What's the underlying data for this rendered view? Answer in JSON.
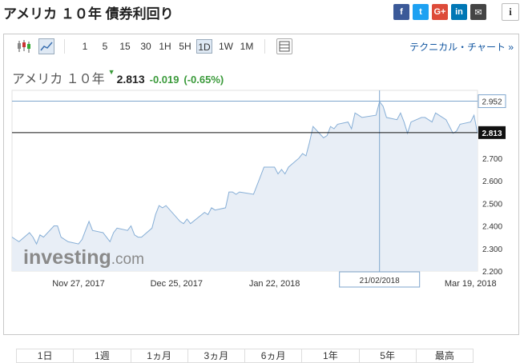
{
  "header": {
    "title": "アメリカ １０年 債券利回り",
    "social": [
      {
        "icon": "facebook-icon",
        "glyph": "f",
        "color": "#3b5998"
      },
      {
        "icon": "twitter-icon",
        "glyph": "t",
        "color": "#1da1f2"
      },
      {
        "icon": "google-plus-icon",
        "glyph": "G+",
        "color": "#dd4b39"
      },
      {
        "icon": "linkedin-icon",
        "glyph": "in",
        "color": "#0077b5"
      },
      {
        "icon": "email-icon",
        "glyph": "✉",
        "color": "#444444"
      }
    ],
    "info_glyph": "i"
  },
  "toolbar": {
    "intervals": [
      "1",
      "5",
      "15",
      "30",
      "1H",
      "5H",
      "1D",
      "1W",
      "1M"
    ],
    "selected": "1D",
    "technical_link": "テクニカル・チャート »"
  },
  "quote": {
    "name": "アメリカ １０年",
    "arrow": "▼",
    "price": "2.813",
    "change": "-0.019",
    "change_pct": "(-0.65%)",
    "change_color": "#3a9a3a"
  },
  "watermark": {
    "brand": "investing",
    "suffix": ".com"
  },
  "chart_data": {
    "type": "area",
    "x": [
      "2017-11-08",
      "2017-11-09",
      "2017-11-10",
      "2017-11-13",
      "2017-11-14",
      "2017-11-15",
      "2017-11-16",
      "2017-11-17",
      "2017-11-20",
      "2017-11-21",
      "2017-11-22",
      "2017-11-24",
      "2017-11-27",
      "2017-11-28",
      "2017-11-29",
      "2017-11-30",
      "2017-12-01",
      "2017-12-04",
      "2017-12-05",
      "2017-12-06",
      "2017-12-07",
      "2017-12-08",
      "2017-12-11",
      "2017-12-12",
      "2017-12-13",
      "2017-12-14",
      "2017-12-15",
      "2017-12-18",
      "2017-12-19",
      "2017-12-20",
      "2017-12-21",
      "2017-12-22",
      "2017-12-26",
      "2017-12-27",
      "2017-12-28",
      "2017-12-29",
      "2018-01-02",
      "2018-01-03",
      "2018-01-04",
      "2018-01-05",
      "2018-01-08",
      "2018-01-09",
      "2018-01-10",
      "2018-01-11",
      "2018-01-12",
      "2018-01-16",
      "2018-01-17",
      "2018-01-18",
      "2018-01-19",
      "2018-01-22",
      "2018-01-23",
      "2018-01-24",
      "2018-01-25",
      "2018-01-26",
      "2018-01-29",
      "2018-01-30",
      "2018-01-31",
      "2018-02-01",
      "2018-02-02",
      "2018-02-05",
      "2018-02-06",
      "2018-02-07",
      "2018-02-08",
      "2018-02-09",
      "2018-02-12",
      "2018-02-13",
      "2018-02-14",
      "2018-02-15",
      "2018-02-16",
      "2018-02-20",
      "2018-02-21",
      "2018-02-22",
      "2018-02-23",
      "2018-02-26",
      "2018-02-27",
      "2018-02-28",
      "2018-03-01",
      "2018-03-02",
      "2018-03-05",
      "2018-03-06",
      "2018-03-07",
      "2018-03-08",
      "2018-03-09",
      "2018-03-12",
      "2018-03-13",
      "2018-03-14",
      "2018-03-15",
      "2018-03-16",
      "2018-03-19",
      "2018-03-20",
      "2018-03-21"
    ],
    "values": [
      2.35,
      2.34,
      2.33,
      2.37,
      2.35,
      2.32,
      2.36,
      2.35,
      2.4,
      2.4,
      2.35,
      2.33,
      2.32,
      2.34,
      2.38,
      2.42,
      2.38,
      2.37,
      2.35,
      2.33,
      2.37,
      2.39,
      2.38,
      2.4,
      2.36,
      2.35,
      2.35,
      2.39,
      2.45,
      2.49,
      2.48,
      2.49,
      2.42,
      2.41,
      2.43,
      2.41,
      2.46,
      2.45,
      2.48,
      2.47,
      2.48,
      2.55,
      2.55,
      2.54,
      2.55,
      2.54,
      2.58,
      2.62,
      2.66,
      2.66,
      2.63,
      2.65,
      2.63,
      2.66,
      2.7,
      2.72,
      2.71,
      2.77,
      2.84,
      2.79,
      2.8,
      2.84,
      2.83,
      2.85,
      2.86,
      2.83,
      2.9,
      2.89,
      2.88,
      2.89,
      2.95,
      2.93,
      2.88,
      2.87,
      2.9,
      2.86,
      2.81,
      2.86,
      2.88,
      2.88,
      2.87,
      2.86,
      2.9,
      2.87,
      2.84,
      2.81,
      2.82,
      2.85,
      2.86,
      2.89,
      2.81
    ],
    "ylim": [
      2.2,
      3.0
    ],
    "y_ticks": [
      "2.200",
      "2.300",
      "2.400",
      "2.500",
      "2.600",
      "2.700"
    ],
    "x_tick_labels": [
      {
        "date": "2017-11-27",
        "label": "Nov 27, 2017"
      },
      {
        "date": "2017-12-25",
        "label": "Dec 25, 2017"
      },
      {
        "date": "2018-01-22",
        "label": "Jan 22, 2018"
      },
      {
        "date": "2018-03-19",
        "label": "Mar 19, 2018"
      }
    ],
    "crosshair": {
      "date": "2018-02-21",
      "label": "21/02/2018",
      "value": "2.952"
    },
    "last_value": "2.813",
    "line_color": "#86aed6",
    "fill_color": "#e8eef6",
    "grid": false
  },
  "timeframes": [
    "1日",
    "1週",
    "1ヵ月",
    "3ヵ月",
    "6ヵ月",
    "1年",
    "5年",
    "最高"
  ]
}
